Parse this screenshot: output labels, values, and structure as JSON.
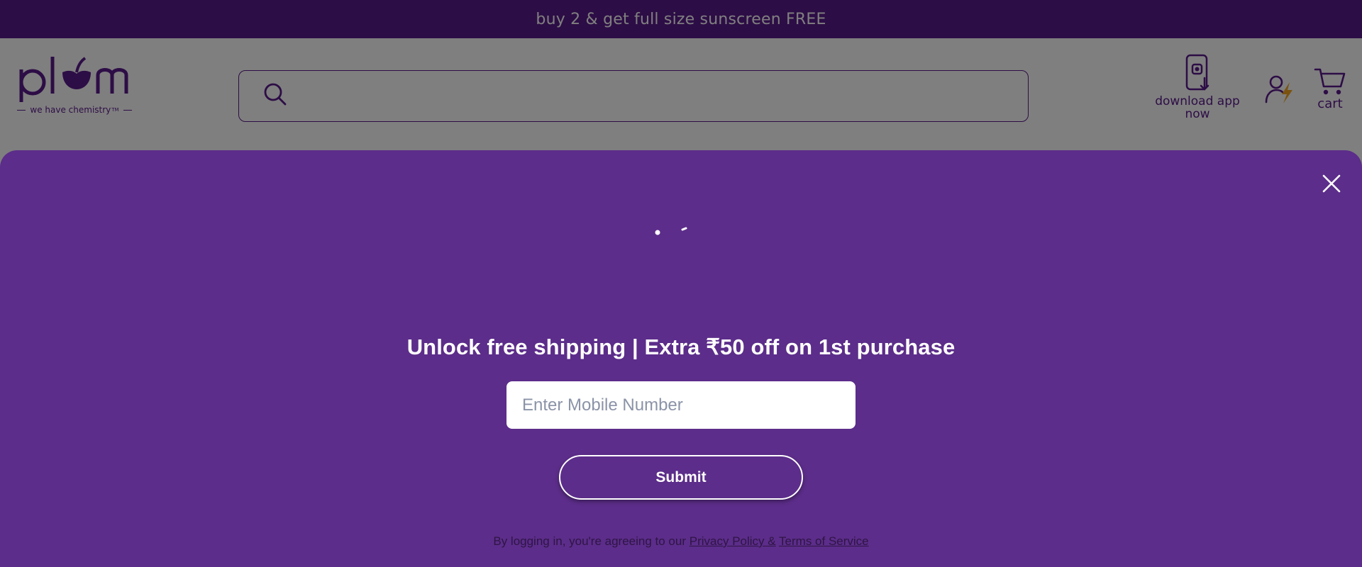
{
  "announcement": {
    "text": "buy 2 & get full size sunscreen FREE"
  },
  "brand": {
    "logo_text": "plum",
    "tagline": "we have chemistry",
    "tagline_mark": "TM"
  },
  "search": {
    "placeholder": ""
  },
  "header": {
    "download_app_label": "download app now",
    "cart_label": "cart"
  },
  "popup": {
    "headline": "Unlock free shipping | Extra ₹50 off on 1st purchase",
    "mobile_placeholder": "Enter Mobile Number",
    "submit_label": "Submit",
    "legal_prefix": "By logging in, you're agreeing to our",
    "privacy_link": "Privacy Policy &",
    "terms_link": "Terms of Service"
  },
  "colors": {
    "brand_purple": "#5a1a8c",
    "popup_purple": "#5c2d8a",
    "accent_orange": "#f5a623"
  },
  "icons": [
    "search-icon",
    "phone-download-icon",
    "account-icon",
    "cart-icon",
    "close-icon"
  ]
}
